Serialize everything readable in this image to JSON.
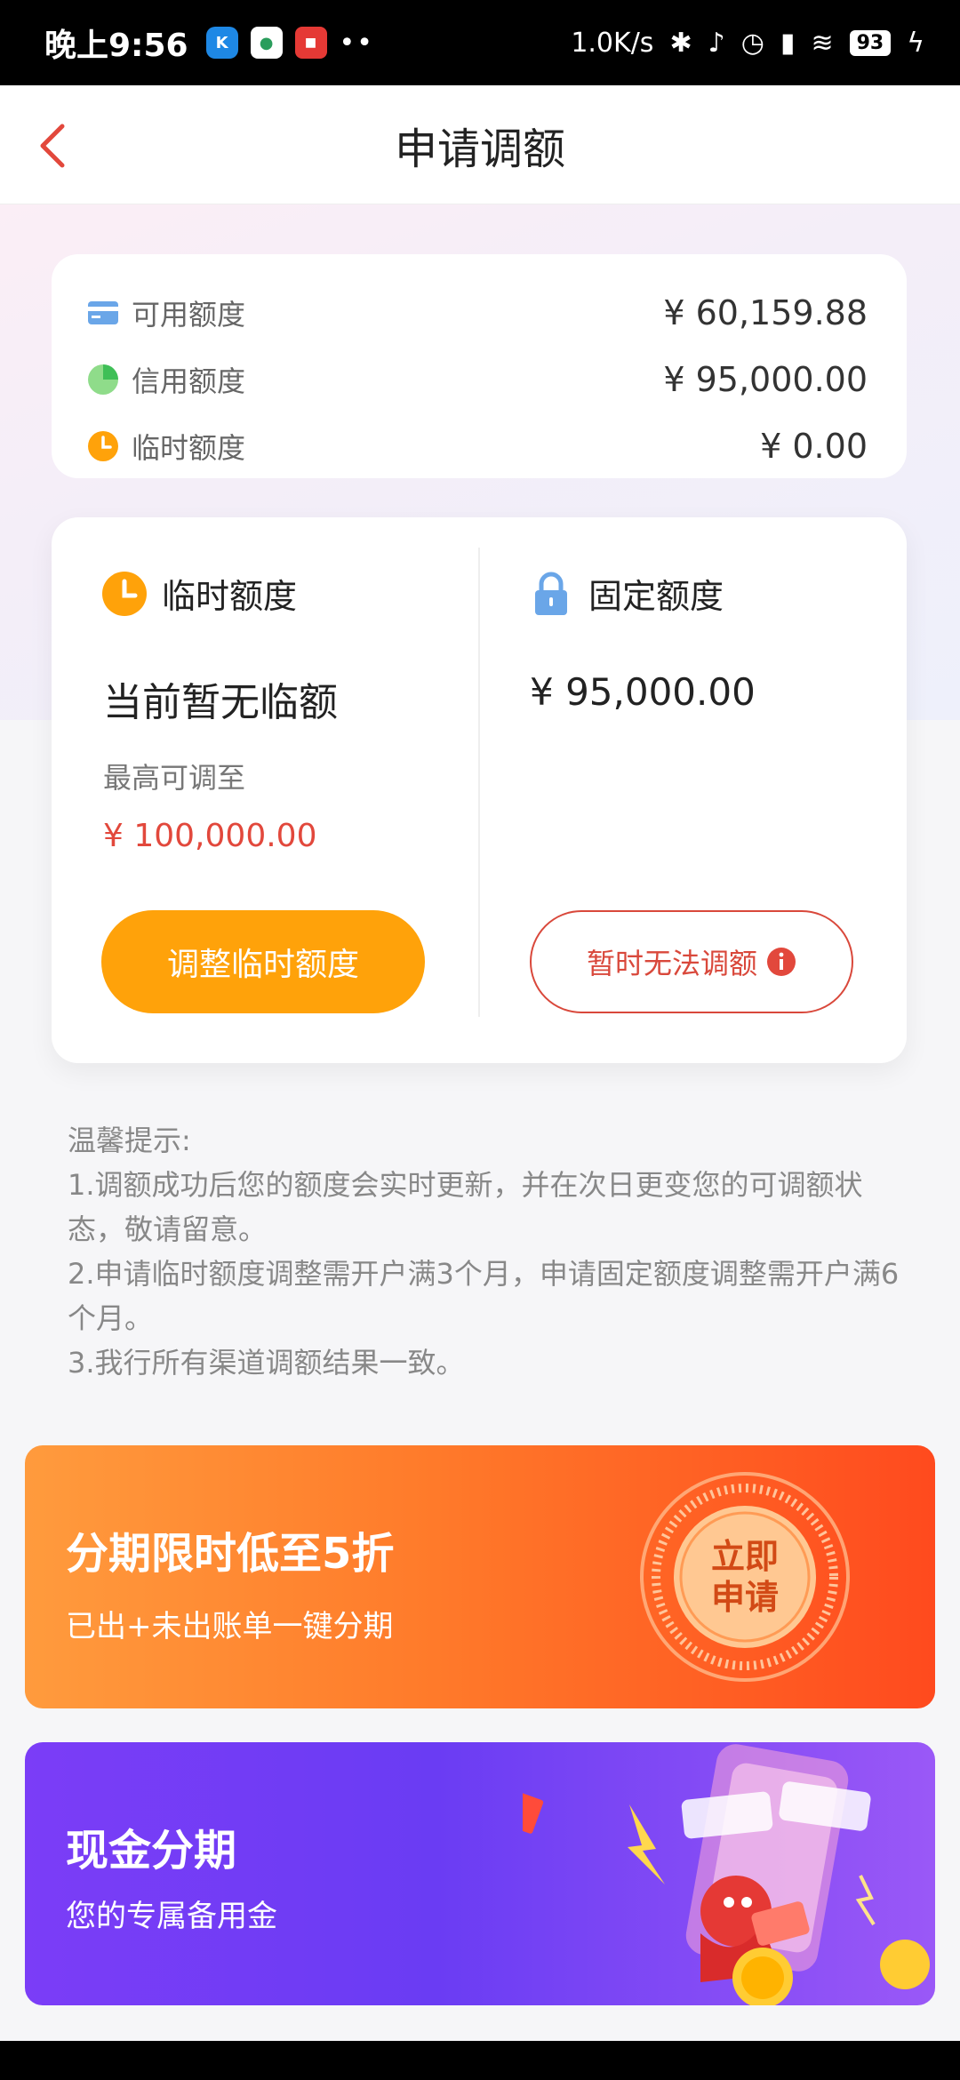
{
  "status_bar": {
    "time": "晚上9:56",
    "dots": "••",
    "net_speed": "1.0K/s",
    "battery": "93"
  },
  "header": {
    "title": "申请调额"
  },
  "summary": {
    "items": [
      {
        "label": "可用额度",
        "value": "¥ 60,159.88",
        "icon": "card-icon"
      },
      {
        "label": "信用额度",
        "value": "¥ 95,000.00",
        "icon": "pie-icon"
      },
      {
        "label": "临时额度",
        "value": "¥ 0.00",
        "icon": "clock-icon"
      }
    ]
  },
  "temp_limit": {
    "title": "临时额度",
    "status": "当前暂无临额",
    "max_label": "最高可调至",
    "max_value": "¥ 100,000.00",
    "button": "调整临时额度"
  },
  "fixed_limit": {
    "title": "固定额度",
    "value": "¥ 95,000.00",
    "button": "暂时无法调额"
  },
  "tips": {
    "title": "温馨提示:",
    "lines": [
      "1.调额成功后您的额度会实时更新，并在次日更变您的可调额状态，敬请留意。",
      "2.申请临时额度调整需开户满3个月，申请固定额度调整需开户满6个月。",
      "3.我行所有渠道调额结果一致。"
    ]
  },
  "banners": {
    "installment": {
      "title": "分期限时低至5折",
      "subtitle": "已出+未出账单一键分期",
      "stamp_line1": "立即",
      "stamp_line2": "申请"
    },
    "cash": {
      "title": "现金分期",
      "subtitle": "您的专属备用金"
    }
  },
  "colors": {
    "accent_orange": "#ffa20a",
    "accent_red": "#e2483c",
    "banner1": "#ff7a2a",
    "banner2": "#6a3cf3"
  }
}
